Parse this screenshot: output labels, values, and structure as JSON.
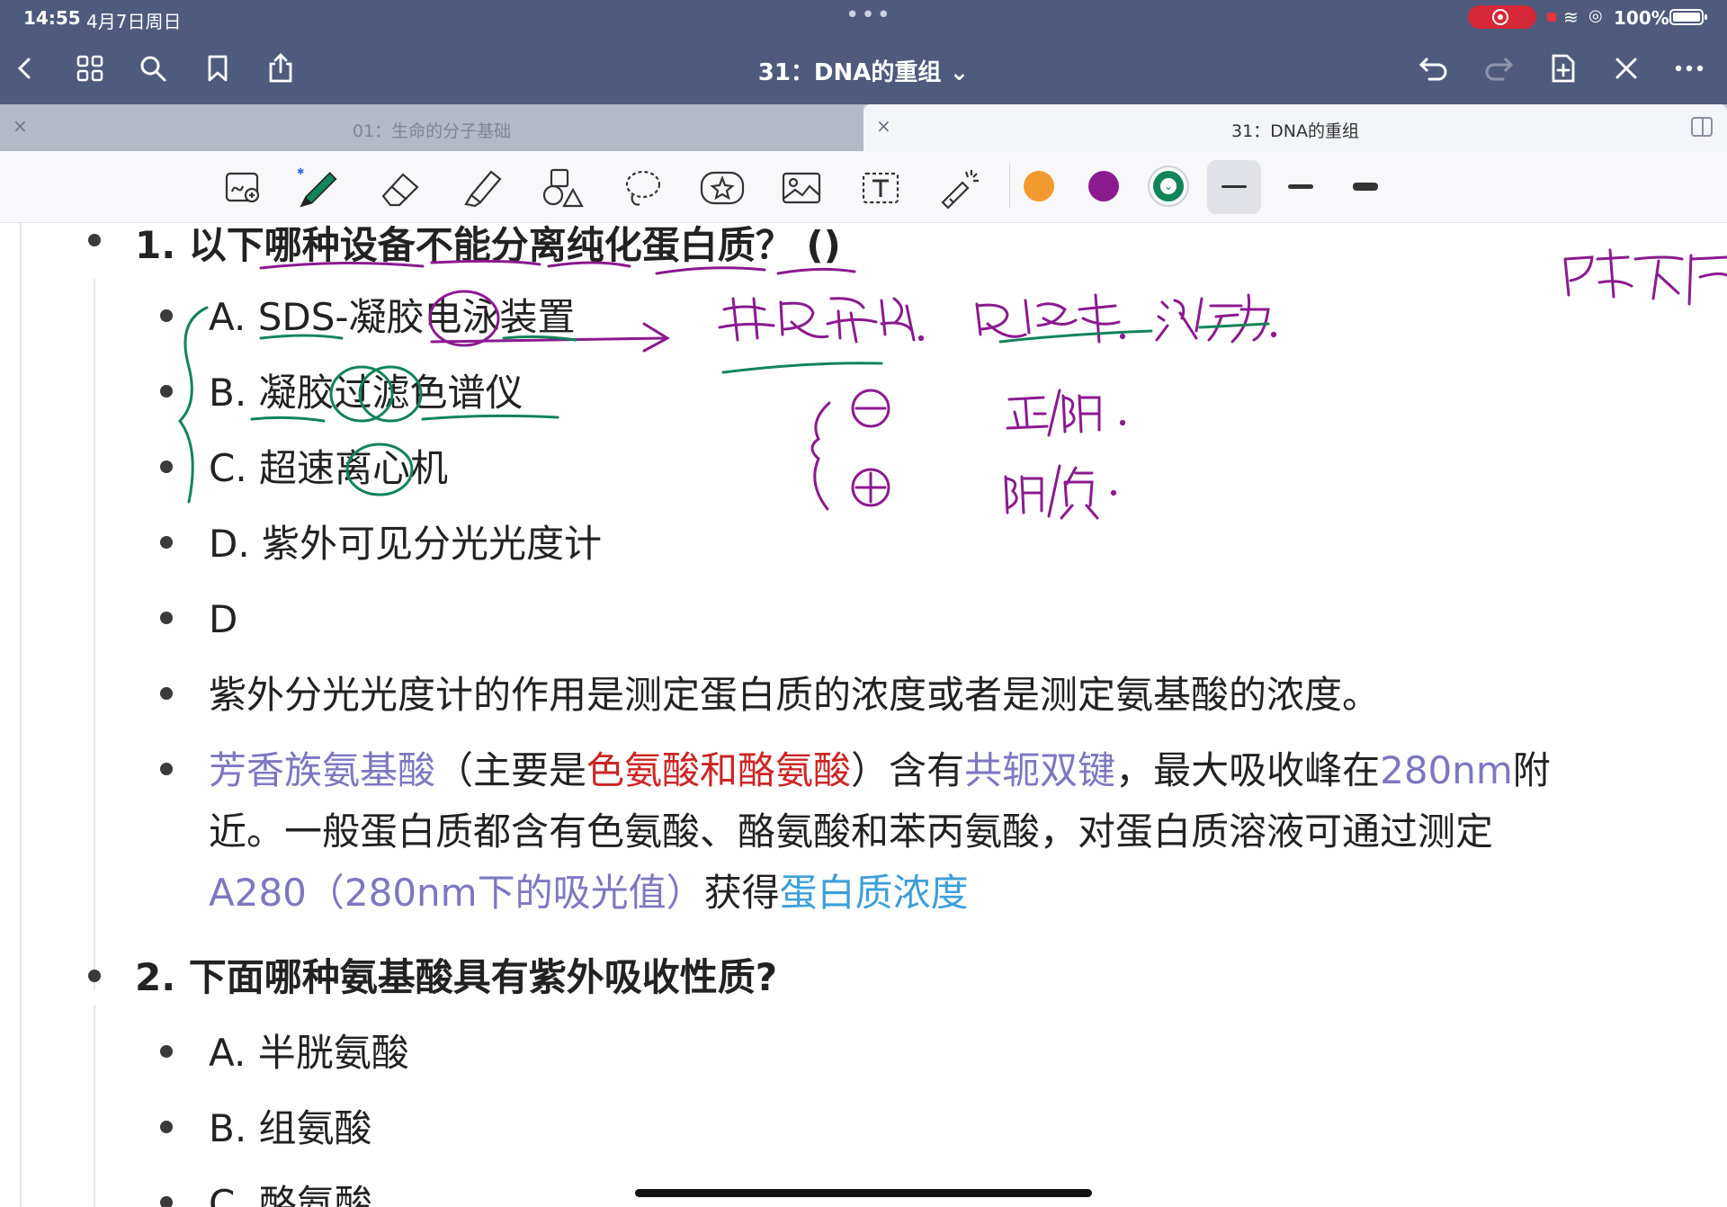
{
  "status_bar": {
    "time": "14:55",
    "date": "4月7日周日",
    "battery": "100%"
  },
  "nav": {
    "title": "31：DNA的重组 ⌄"
  },
  "tabs": [
    {
      "label": "01：生命的分子基础",
      "active": false
    },
    {
      "label": "31：DNA的重组",
      "active": true
    }
  ],
  "toolbar": {
    "tools": [
      "zoom-pen-icon",
      "pen-icon",
      "eraser-icon",
      "highlighter-icon",
      "shapes-icon",
      "lasso-icon",
      "sticker-icon",
      "image-icon",
      "text-icon",
      "laser-icon"
    ],
    "colors": [
      "#f29a2e",
      "#8b1a8f",
      "#12845a"
    ],
    "selected_color": "#12845a"
  },
  "content": {
    "q1_title": "1. 以下哪种设备不能分离纯化蛋白质？ ()",
    "q1_options": [
      "A. SDS-凝胶电泳装置",
      "B. 凝胶过滤色谱仪",
      "C. 超速离心机",
      "D. 紫外可见分光光度计"
    ],
    "q1_answer": "D",
    "q1_explain": "紫外分光光度计的作用是测定蛋白质的浓度或者是测定氨基酸的浓度。",
    "q1_note": {
      "aromatic": "芳香族氨基酸",
      "p1": "（主要是",
      "trp_tyr": "色氨酸和酪氨酸",
      "p2": "）含有",
      "conj": "共轭双键",
      "p3": "，最大吸收峰在",
      "nm": "280nm",
      "p4": "附",
      "line2": "近。一般蛋白质都含有色氨酸、酪氨酸和苯丙氨酸，对蛋白质溶液可通过测定",
      "a280": "A280（280nm下的吸光值）",
      "p5": "获得",
      "conc": "蛋白质浓度"
    },
    "q2_title": "2. 下面哪种氨基酸具有紫外吸收性质?",
    "q2_options": [
      "A. 半胱氨酸",
      "B. 组氨酸",
      "C. 酪氨酸"
    ]
  }
}
